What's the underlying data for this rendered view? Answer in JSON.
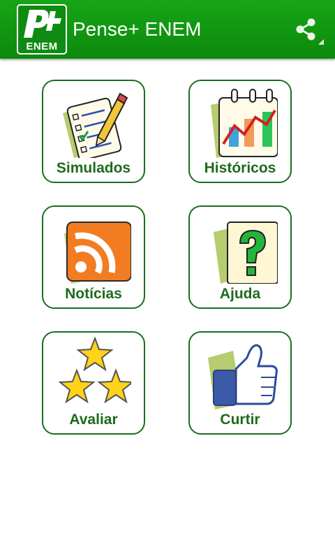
{
  "app": {
    "title": "Pense+ ENEM",
    "logo_text": "ENEM",
    "logo_letters": "P+",
    "share_icon": "share-icon",
    "primary_color": "#109a10"
  },
  "tiles": [
    {
      "label": "Simulados",
      "icon": "checklist-pencil-icon"
    },
    {
      "label": "Históricos",
      "icon": "calendar-chart-icon"
    },
    {
      "label": "Notícias",
      "icon": "rss-feed-icon"
    },
    {
      "label": "Ajuda",
      "icon": "question-mark-icon"
    },
    {
      "label": "Avaliar",
      "icon": "stars-icon"
    },
    {
      "label": "Curtir",
      "icon": "thumbs-up-icon"
    }
  ]
}
